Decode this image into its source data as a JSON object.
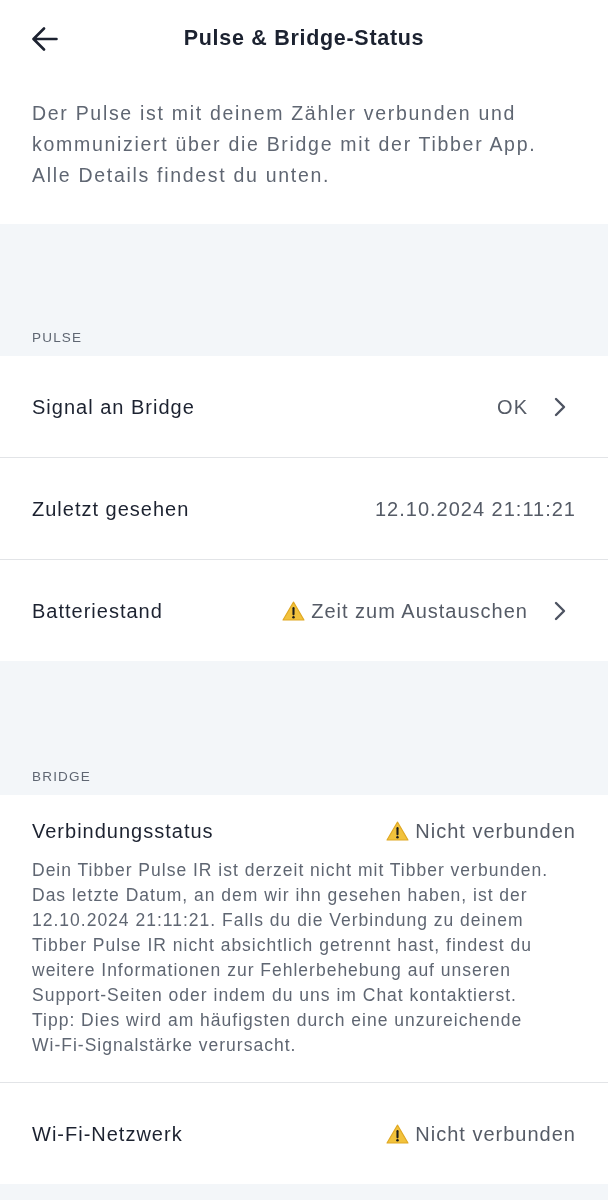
{
  "header": {
    "title": "Pulse & Bridge-Status"
  },
  "intro": "Der Pulse ist mit deinem Zähler verbunden und kommuniziert über die Bridge mit der Tibber App. Alle Details findest du unten.",
  "sections": [
    {
      "title": "PULSE",
      "rows": [
        {
          "kind": "link",
          "label": "Signal an Bridge",
          "value": "OK",
          "warning": false
        },
        {
          "kind": "info",
          "label": "Zuletzt gesehen",
          "value": "12.10.2024 21:11:21",
          "warning": false
        },
        {
          "kind": "link",
          "label": "Batteriestand",
          "value": "Zeit zum Austauschen",
          "warning": true
        }
      ]
    },
    {
      "title": "BRIDGE",
      "rows": [
        {
          "kind": "info",
          "label": "Verbindungsstatus",
          "value": "Nicht verbunden",
          "warning": true,
          "description": "Dein Tibber Pulse IR ist derzeit nicht mit Tibber verbunden. Das letzte Datum, an dem wir ihn gesehen haben, ist der 12.10.2024 21:11:21. Falls du die Verbindung zu deinem Tibber Pulse IR nicht absichtlich getrennt hast, findest du weitere Informationen zur Fehlerbehebung auf unseren Support-Seiten oder indem du uns im Chat kontaktierst. Tipp: Dies wird am häufigsten durch eine unzureichende Wi-Fi-Signalstärke verursacht."
        },
        {
          "kind": "info",
          "label": "Wi-Fi-Netzwerk",
          "value": "Nicht verbunden",
          "warning": true
        }
      ]
    }
  ]
}
